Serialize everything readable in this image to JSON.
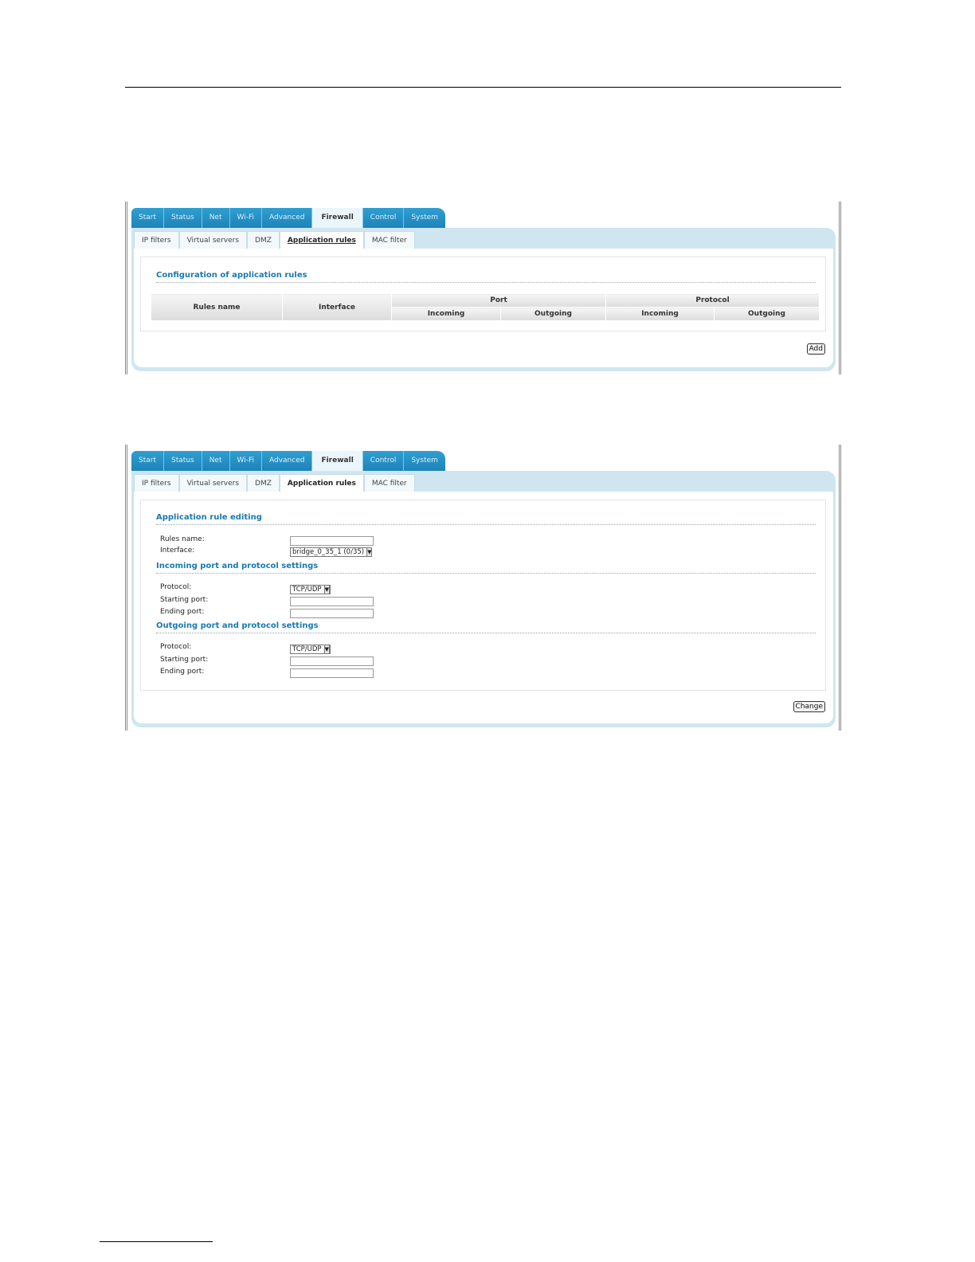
{
  "nav": {
    "tabs": [
      "Start",
      "Status",
      "Net",
      "Wi-Fi",
      "Advanced",
      "Firewall",
      "Control",
      "System"
    ],
    "active_tab": "Firewall"
  },
  "subnav": {
    "tabs": [
      "IP filters",
      "Virtual servers",
      "DMZ",
      "Application rules",
      "MAC filter"
    ],
    "active_tab": "Application rules"
  },
  "screen1": {
    "section_title": "Configuration of application rules",
    "table": {
      "col_rules_name": "Rules name",
      "col_interface": "Interface",
      "group_port": "Port",
      "group_protocol": "Protocol",
      "port_incoming": "Incoming",
      "port_outgoing": "Outgoing",
      "protocol_incoming": "Incoming",
      "protocol_outgoing": "Outgoing"
    },
    "add_button": "Add"
  },
  "screen2": {
    "section_title": "Application rule editing",
    "rules_name_label": "Rules name:",
    "rules_name_value": "",
    "interface_label": "Interface:",
    "interface_value": "bridge_0_35_1 (0/35)",
    "incoming": {
      "title": "Incoming port and protocol settings",
      "protocol_label": "Protocol:",
      "protocol_value": "TCP/UDP",
      "starting_port_label": "Starting port:",
      "starting_port_value": "",
      "ending_port_label": "Ending port:",
      "ending_port_value": ""
    },
    "outgoing": {
      "title": "Outgoing port and protocol settings",
      "protocol_label": "Protocol:",
      "protocol_value": "TCP/UDP",
      "starting_port_label": "Starting port:",
      "starting_port_value": "",
      "ending_port_label": "Ending port:",
      "ending_port_value": ""
    },
    "change_button": "Change"
  }
}
